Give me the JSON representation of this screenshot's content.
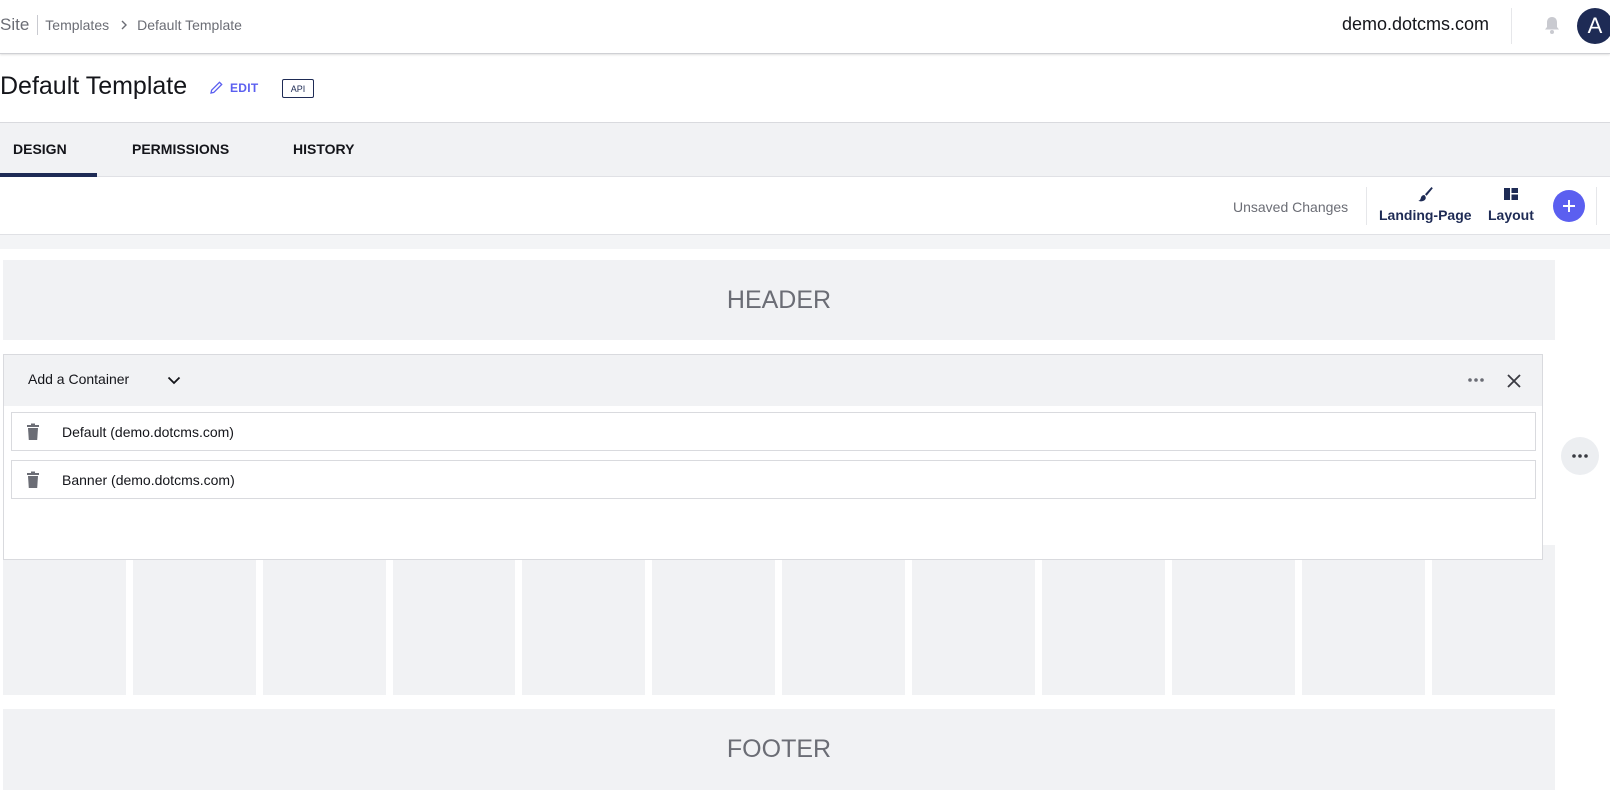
{
  "breadcrumb": {
    "site": "Site",
    "templates": "Templates",
    "current": "Default Template"
  },
  "header": {
    "site_name": "demo.dotcms.com",
    "avatar_letter": "A"
  },
  "title": {
    "text": "Default Template",
    "edit_label": "EDIT",
    "api_label": "API"
  },
  "tabs": [
    {
      "label": "DESIGN",
      "active": true
    },
    {
      "label": "PERMISSIONS",
      "active": false
    },
    {
      "label": "HISTORY",
      "active": false
    }
  ],
  "toolbar": {
    "status": "Unsaved Changes",
    "landing_page_label": "Landing-Page",
    "layout_label": "Layout"
  },
  "layout": {
    "header_label": "HEADER",
    "footer_label": "FOOTER",
    "column_count": 12
  },
  "container_box": {
    "add_label": "Add a Container",
    "items": [
      {
        "label": "Default (demo.dotcms.com)"
      },
      {
        "label": "Banner (demo.dotcms.com)"
      }
    ]
  },
  "colors": {
    "accent": "#5b5ff0",
    "navy": "#1e2b55",
    "panel": "#f1f2f4",
    "muted_text": "#6b6d75"
  }
}
